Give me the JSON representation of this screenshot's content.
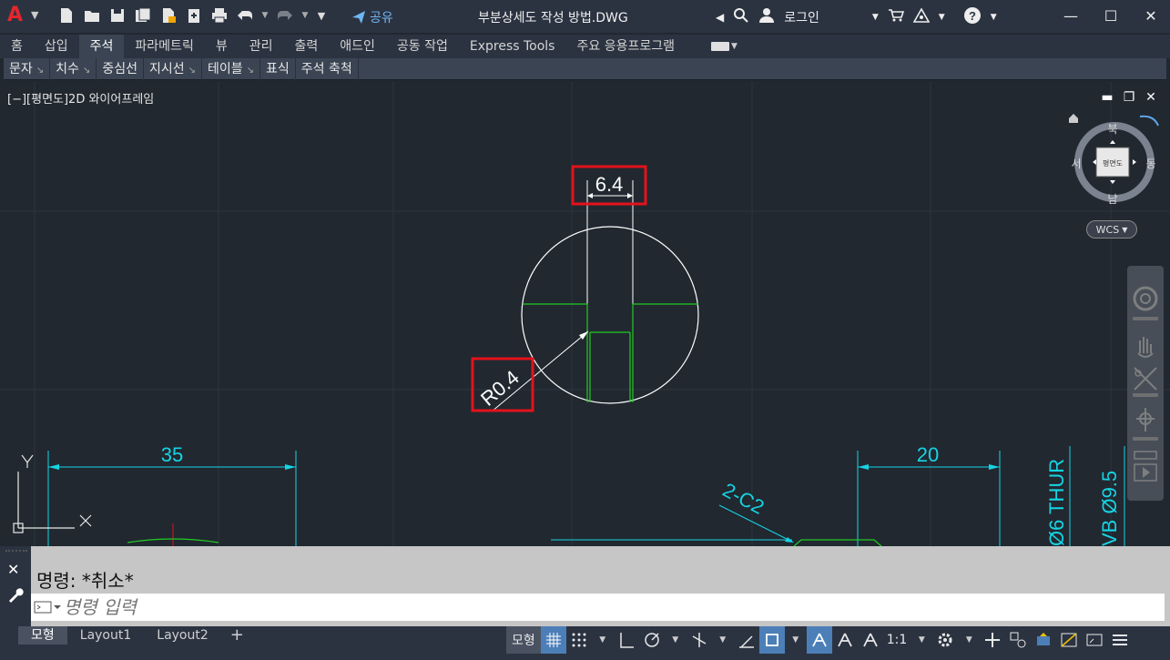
{
  "app": {
    "logo": "A",
    "document_title": "부분상세도 작성 방법.DWG",
    "share_label": "공유",
    "login_label": "로그인"
  },
  "ribbon": {
    "tabs": [
      "홈",
      "삽입",
      "주석",
      "파라메트릭",
      "뷰",
      "관리",
      "출력",
      "애드인",
      "공동 작업",
      "Express Tools",
      "주요 응용프로그램"
    ],
    "active_tab": "주석",
    "panels": [
      {
        "label": "문자",
        "has_arrow": true
      },
      {
        "label": "치수",
        "has_arrow": true
      },
      {
        "label": "중심선",
        "has_arrow": false
      },
      {
        "label": "지시선",
        "has_arrow": true
      },
      {
        "label": "테이블",
        "has_arrow": true
      },
      {
        "label": "표식",
        "has_arrow": false
      },
      {
        "label": "주석 축척",
        "has_arrow": false
      }
    ]
  },
  "viewport": {
    "label": "[−][평면도]2D 와이어프레임"
  },
  "viewcube": {
    "north": "북",
    "south": "남",
    "east": "동",
    "west": "서",
    "face": "평면도",
    "wcs": "WCS"
  },
  "drawing": {
    "dim_width": "6.4",
    "dim_radius": "R0.4",
    "dim_left": "35",
    "dim_right": "20",
    "chamfer": "2-C2",
    "vertical_note_1": "Ø6 THUR",
    "vertical_note_2": "VB Ø9.5",
    "ucs_y": "Y"
  },
  "command": {
    "history": "명령:  *취소*",
    "placeholder": "명령 입력"
  },
  "status": {
    "layout_tabs": [
      "모형",
      "Layout1",
      "Layout2"
    ],
    "active_layout": "모형",
    "add_tab": "+",
    "model_btn": "모형",
    "scale": "1:1"
  },
  "colors": {
    "background": "#212830",
    "cyan_dim": "#16d4e4",
    "green_geom": "#22cc22",
    "highlight_red": "#e3121b",
    "white_geom": "#ffffff"
  }
}
